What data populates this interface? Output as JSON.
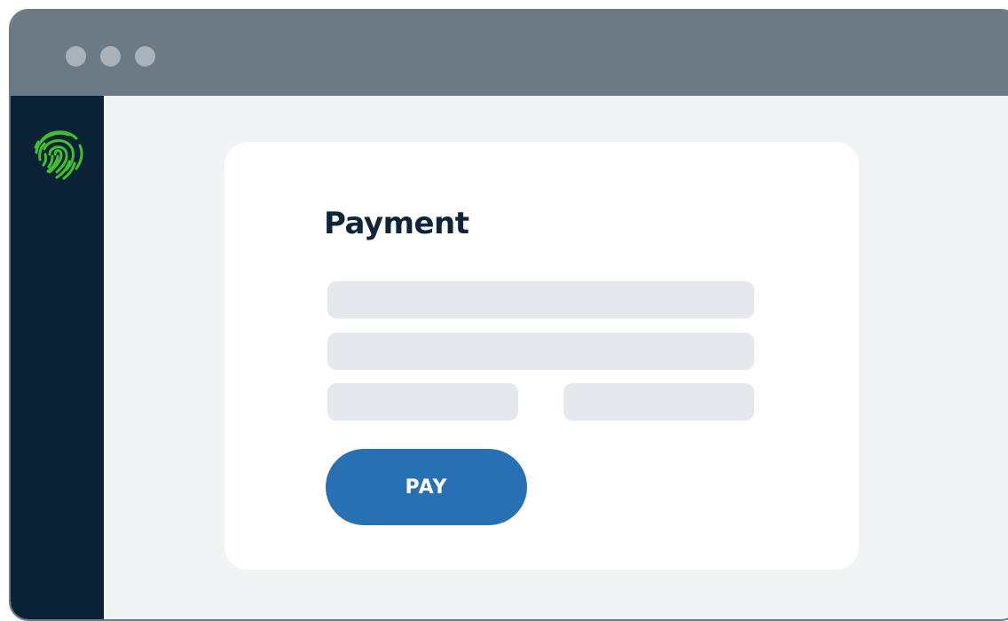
{
  "window": {
    "titlebar_color": "#6c7a85",
    "traffic_lights": [
      "window-dot",
      "window-dot",
      "window-dot"
    ]
  },
  "sidebar": {
    "logo_icon": "fingerprint-icon",
    "logo_color": "#3fc12e",
    "background": "#0b2236"
  },
  "payment": {
    "title": "Payment",
    "fields": [
      {
        "value": "",
        "placeholder": ""
      },
      {
        "value": "",
        "placeholder": ""
      },
      {
        "value": "",
        "placeholder": ""
      },
      {
        "value": "",
        "placeholder": ""
      }
    ],
    "pay_label": "PAY",
    "accent": "#2870b4"
  }
}
